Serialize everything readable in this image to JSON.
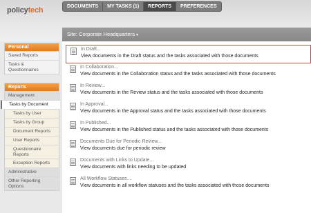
{
  "app": {
    "logo_prefix": "policy",
    "logo_suffix": "tech"
  },
  "topnav": {
    "items": [
      {
        "label": "DOCUMENTS"
      },
      {
        "label": "MY TASKS (1)"
      },
      {
        "label": "REPORTS"
      },
      {
        "label": "PREFERENCES"
      }
    ],
    "active": "REPORTS"
  },
  "site": {
    "label": "Site: Corporate Headquarters",
    "caret": "▾"
  },
  "sidebar": {
    "personal": {
      "header": "Personal",
      "items": [
        "Saved Reports",
        "Tasks & Questionnaires"
      ]
    },
    "reports": {
      "header": "Reports",
      "management_label": "Management",
      "sub_items": [
        "Tasks by Document",
        "Tasks by User",
        "Tasks by Group",
        "Document Reports",
        "User Reports",
        "Questionnaire Reports",
        "Exception Reports"
      ],
      "selected": "Tasks by Document",
      "administrative_label": "Administrative",
      "other_label": "Other Reporting Options"
    }
  },
  "reports": [
    {
      "title": "In Draft...",
      "desc": "View documents in the Draft status and the tasks associated with those documents"
    },
    {
      "title": "In Collaboration...",
      "desc": "View documents in the Collaboration status and the tasks associated with those documents"
    },
    {
      "title": "In Review...",
      "desc": "View documents in the Review status and the tasks associated with those documents"
    },
    {
      "title": "In Approval...",
      "desc": "View documents in the Approval status and the tasks associated with those documents"
    },
    {
      "title": "In Published...",
      "desc": "View documents in the Published status and the tasks associated with those documents"
    },
    {
      "title": "Documents Due for Periodic Review...",
      "desc": "View documents due for periodic review"
    },
    {
      "title": "Documents with Links to Update...",
      "desc": "View documents with links needing to be updated"
    },
    {
      "title": "All Workflow Statuses...",
      "desc": "View documents in all workflow statuses and the tasks associated with those documents"
    }
  ],
  "colors": {
    "accent_orange": "#e07b1e",
    "highlight_red": "#d9394b"
  },
  "icons": {
    "report_icon": "document-icon",
    "site_caret": "chevron-down-icon"
  }
}
